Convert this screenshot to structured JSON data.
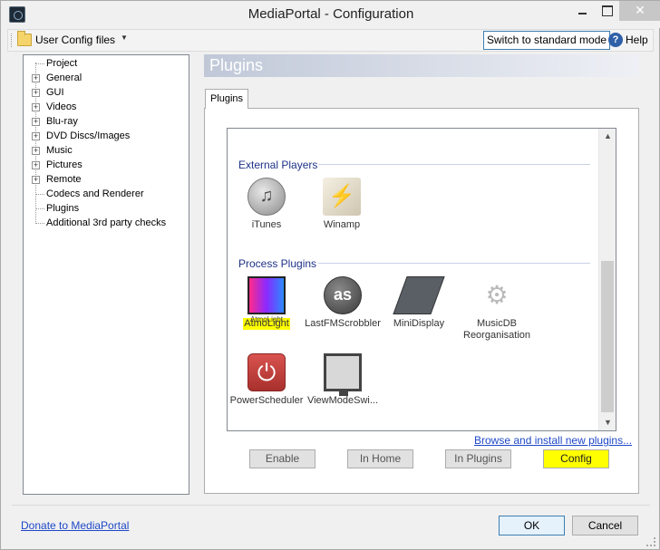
{
  "window": {
    "title": "MediaPortal - Configuration",
    "close_glyph": "✕"
  },
  "toolbar": {
    "config_files_label": "User Config files",
    "dropdown_glyph": "▼",
    "switch_mode_label": "Switch to standard mode",
    "help_glyph": "?",
    "help_label": "Help"
  },
  "tree": {
    "items": [
      {
        "label": "Project",
        "expandable": false
      },
      {
        "label": "General",
        "expandable": true
      },
      {
        "label": "GUI",
        "expandable": true
      },
      {
        "label": "Videos",
        "expandable": true
      },
      {
        "label": "Blu-ray",
        "expandable": true
      },
      {
        "label": "DVD Discs/Images",
        "expandable": true
      },
      {
        "label": "Music",
        "expandable": true
      },
      {
        "label": "Pictures",
        "expandable": true
      },
      {
        "label": "Remote",
        "expandable": true
      },
      {
        "label": "Codecs and Renderer",
        "expandable": false
      },
      {
        "label": "Plugins",
        "expandable": false,
        "selected": true
      },
      {
        "label": "Additional 3rd party checks",
        "expandable": false
      }
    ],
    "expander_glyph": "+"
  },
  "panel": {
    "header": "Plugins",
    "tab_label": "Plugins",
    "groups": [
      {
        "title": "External Players",
        "plugins": [
          {
            "label": "iTunes",
            "icon": "itunes-icon"
          },
          {
            "label": "Winamp",
            "icon": "winamp-icon"
          }
        ]
      },
      {
        "title": "Process Plugins",
        "plugins": [
          {
            "label": "AtmoLight",
            "icon": "atmolight-icon",
            "highlighted": true
          },
          {
            "label": "LastFMScrobbler",
            "icon": "lastfm-icon"
          },
          {
            "label": "MiniDisplay",
            "icon": "minidisplay-icon"
          },
          {
            "label": "MusicDB Reorganisation",
            "icon": "musicdb-icon"
          },
          {
            "label": "PowerScheduler",
            "icon": "power-icon"
          },
          {
            "label": "ViewModeSwi...",
            "icon": "viewmode-icon"
          }
        ]
      }
    ],
    "browse_link": "Browse and install new plugins...",
    "buttons": {
      "enable": "Enable",
      "in_home": "In Home",
      "in_plugins": "In Plugins",
      "config": "Config"
    },
    "scroll_up_glyph": "▲",
    "scroll_down_glyph": "▼"
  },
  "footer": {
    "donate_link": "Donate to MediaPortal",
    "ok_label": "OK",
    "cancel_label": "Cancel"
  },
  "colors": {
    "highlight": "#ffff00",
    "group_title": "#1e3287",
    "link": "#1e48c8"
  }
}
